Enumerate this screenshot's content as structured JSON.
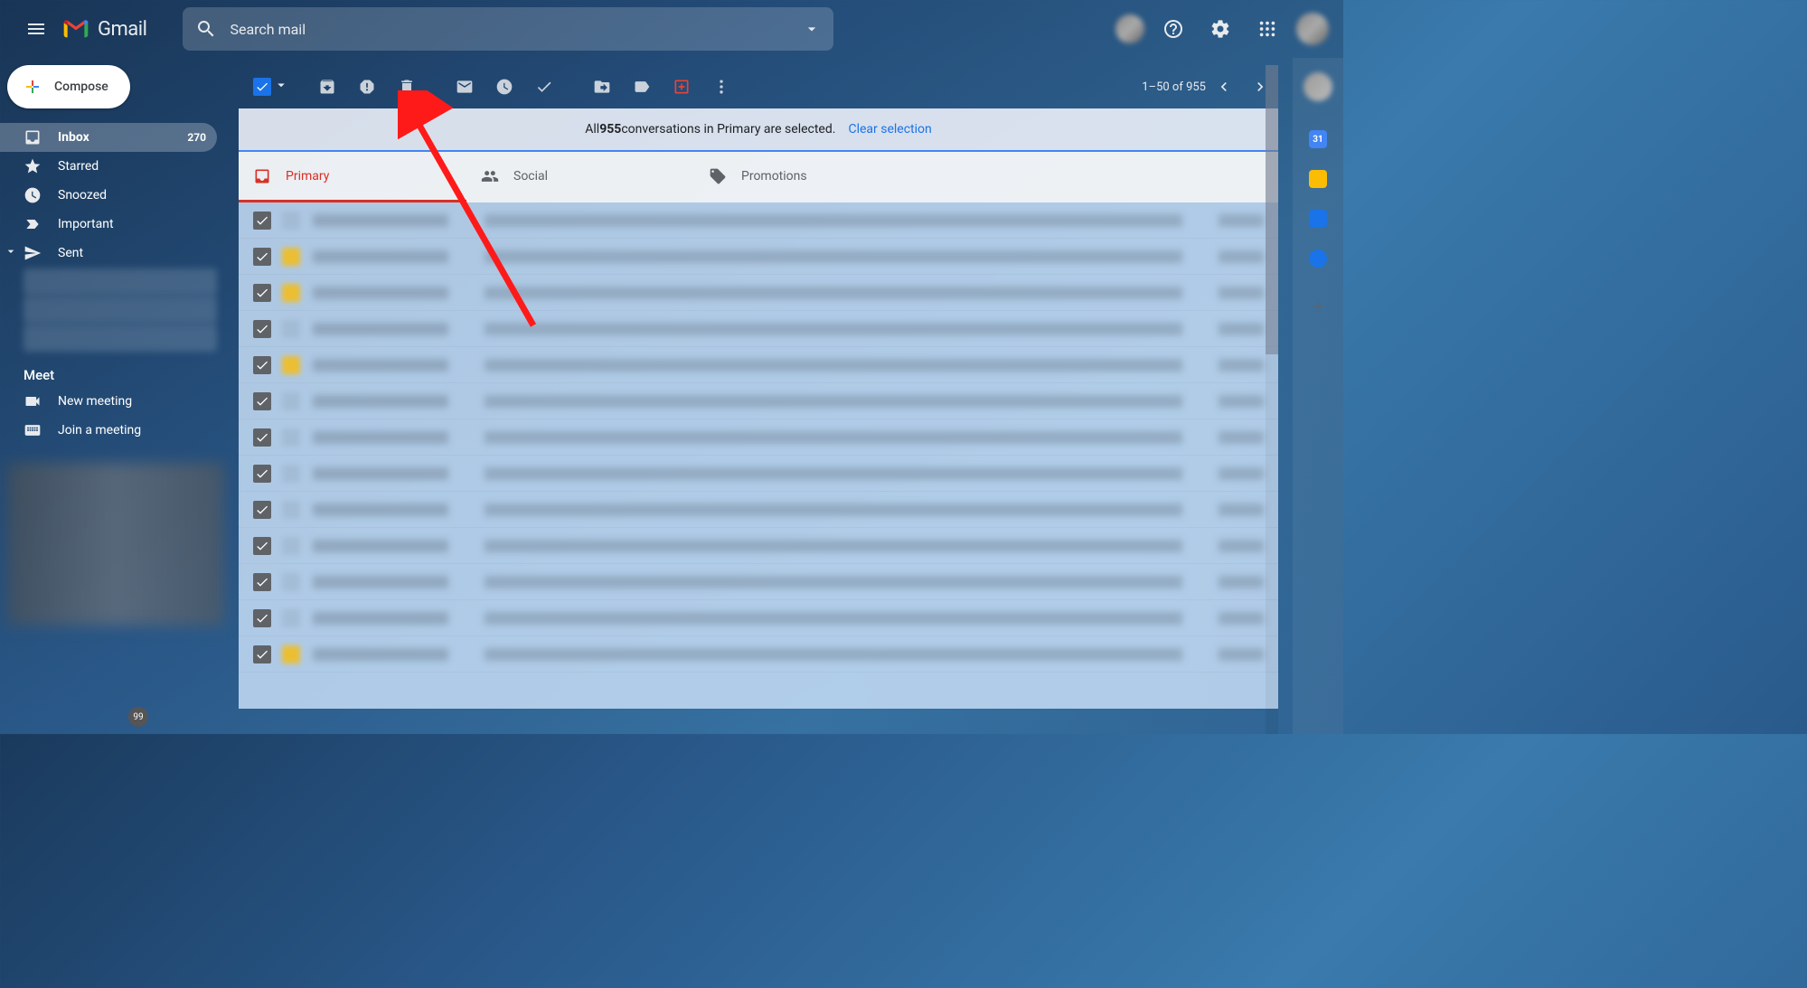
{
  "header": {
    "product_name": "Gmail",
    "search_placeholder": "Search mail"
  },
  "sidebar": {
    "compose_label": "Compose",
    "items": [
      {
        "label": "Inbox",
        "count": "270",
        "active": true,
        "icon": "inbox"
      },
      {
        "label": "Starred",
        "icon": "star"
      },
      {
        "label": "Snoozed",
        "icon": "clock"
      },
      {
        "label": "Important",
        "icon": "important"
      },
      {
        "label": "Sent",
        "icon": "sent",
        "expandable": true
      }
    ],
    "meet_header": "Meet",
    "meet_items": [
      {
        "label": "New meeting",
        "icon": "video"
      },
      {
        "label": "Join a meeting",
        "icon": "keyboard"
      }
    ]
  },
  "toolbar": {
    "pagination_text": "1–50 of 955"
  },
  "selection_banner": {
    "prefix": "All ",
    "count": "955",
    "suffix": " conversations in Primary are selected.",
    "clear_label": "Clear selection"
  },
  "tabs": [
    {
      "label": "Primary",
      "active": true
    },
    {
      "label": "Social"
    },
    {
      "label": "Promotions"
    }
  ],
  "mail_rows": 13
}
